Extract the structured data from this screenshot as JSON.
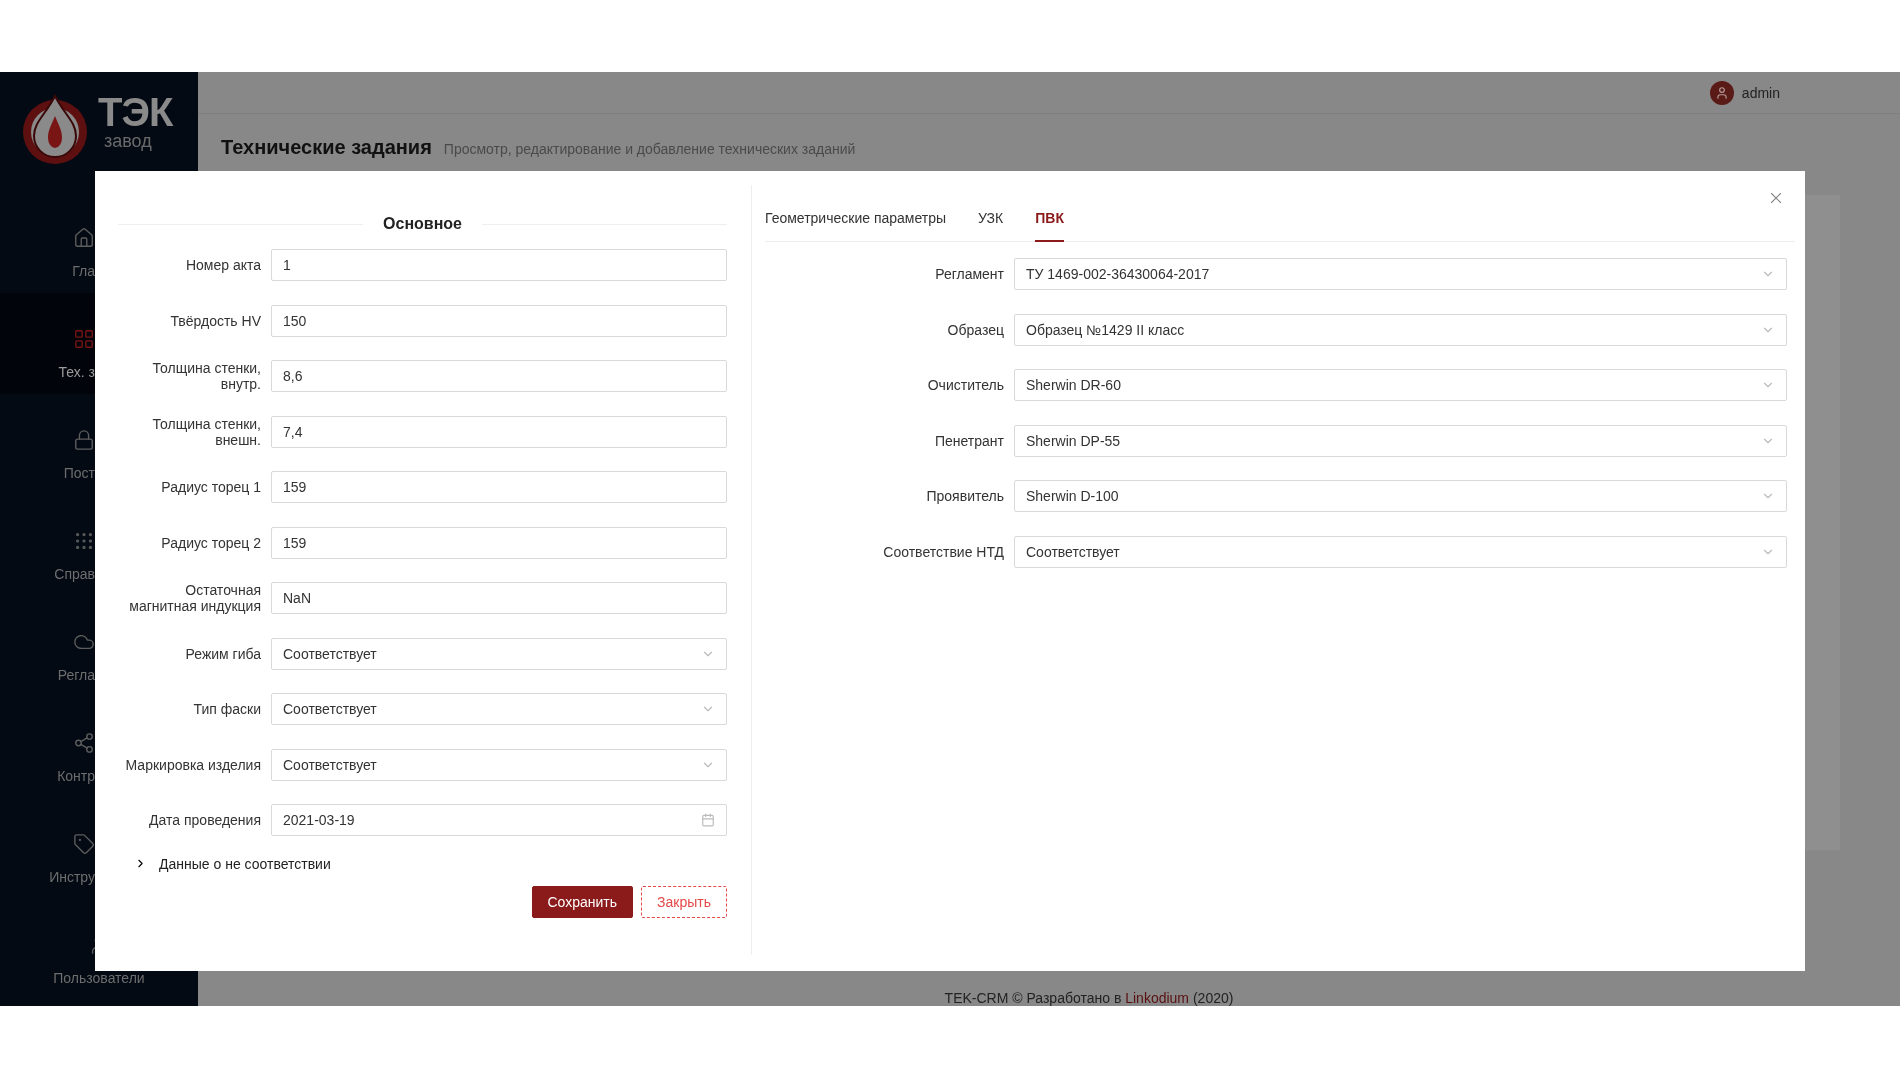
{
  "brand": {
    "name": "ТЭК",
    "sub": "завод"
  },
  "sidebar": {
    "items": [
      {
        "label": "Гла",
        "selected": false
      },
      {
        "label": "Тех. з",
        "selected": true
      },
      {
        "label": "Пост",
        "selected": false
      },
      {
        "label": "Справ",
        "selected": false
      },
      {
        "label": "Регла",
        "selected": false
      },
      {
        "label": "Контр",
        "selected": false
      },
      {
        "label": "Инстру",
        "selected": false
      },
      {
        "label": "Пользователи",
        "selected": false
      }
    ]
  },
  "user": {
    "name": "admin"
  },
  "page": {
    "title": "Технические задания",
    "subtitle": "Просмотр, редактирование и добавление технических заданий"
  },
  "modal": {
    "section_title": "Основное",
    "fields": [
      {
        "label": "Номер акта",
        "value": "1",
        "kind": "text"
      },
      {
        "label": "Твёрдость HV",
        "value": "150",
        "kind": "text"
      },
      {
        "label": "Толщина стенки, внутр.",
        "value": "8,6",
        "kind": "text"
      },
      {
        "label": "Толщина стенки, внешн.",
        "value": "7,4",
        "kind": "text"
      },
      {
        "label": "Радиус торец 1",
        "value": "159",
        "kind": "text"
      },
      {
        "label": "Радиус торец 2",
        "value": "159",
        "kind": "text"
      },
      {
        "label": "Остаточная магнитная индукция",
        "value": "NaN",
        "kind": "text"
      },
      {
        "label": "Режим гиба",
        "value": "Соответствует",
        "kind": "select"
      },
      {
        "label": "Тип фаски",
        "value": "Соответствует",
        "kind": "select"
      },
      {
        "label": "Маркировка изделия",
        "value": "Соответствует",
        "kind": "select"
      },
      {
        "label": "Дата проведения",
        "value": "2021-03-19",
        "kind": "date"
      }
    ],
    "collapse": {
      "label": "Данные о не соответствии",
      "expanded": false
    },
    "buttons": [
      {
        "label": "Сохранить",
        "kind": "primary"
      },
      {
        "label": "Закрыть",
        "kind": "dashed"
      }
    ],
    "tabs": [
      {
        "label": "Геометрические параметры",
        "selected": false
      },
      {
        "label": "УЗК",
        "selected": false
      },
      {
        "label": "ПВК",
        "selected": true
      }
    ],
    "tab_fields": [
      {
        "label": "Регламент",
        "value": "ТУ 1469-002-36430064-2017"
      },
      {
        "label": "Образец",
        "value": "Образец №1429 II класс"
      },
      {
        "label": "Очиститель",
        "value": "Sherwin DR-60"
      },
      {
        "label": "Пенетрант",
        "value": "Sherwin DP-55"
      },
      {
        "label": "Проявитель",
        "value": "Sherwin D-100"
      },
      {
        "label": "Соответствие НТД",
        "value": "Соответствует"
      }
    ]
  },
  "footer": {
    "text": "TEK-CRM © Разработано в ",
    "link": "Linkodium",
    "suffix": " (2020)"
  }
}
